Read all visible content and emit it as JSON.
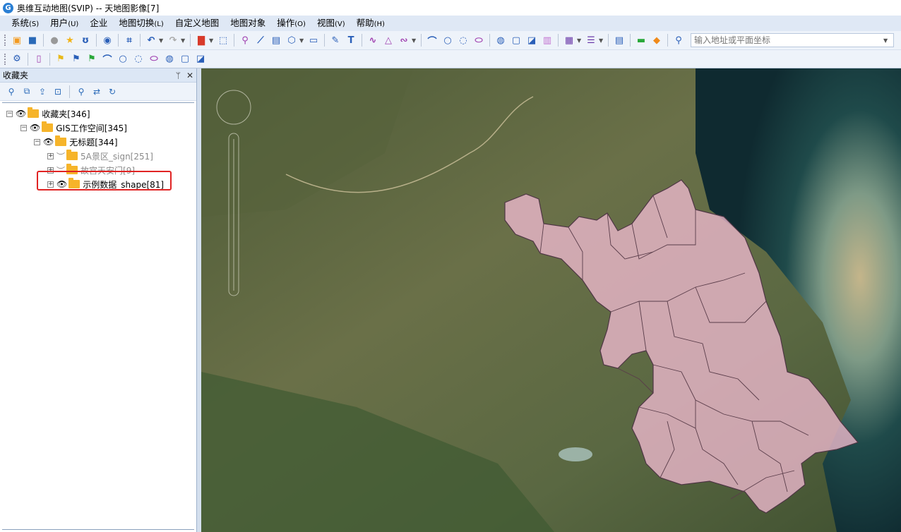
{
  "window": {
    "title": "奥维互动地图(SVIP) -- 天地图影像[7]",
    "icon": "app-logo-icon"
  },
  "menu": [
    {
      "label": "系统",
      "key": "(S)"
    },
    {
      "label": "用户",
      "key": "(U)"
    },
    {
      "label": "企业",
      "key": ""
    },
    {
      "label": "地图切换",
      "key": "(L)"
    },
    {
      "label": "自定义地图",
      "key": ""
    },
    {
      "label": "地图对象",
      "key": ""
    },
    {
      "label": "操作",
      "key": "(O)"
    },
    {
      "label": "视图",
      "key": "(V)"
    },
    {
      "label": "帮助",
      "key": "(H)"
    }
  ],
  "search": {
    "placeholder": "输入地址或平面坐标"
  },
  "panel": {
    "title": "收藏夹",
    "pin_icon": "pin-icon",
    "close_icon": "close-icon"
  },
  "tree": {
    "root": "收藏夹[346]",
    "workspace": "GIS工作空间[345]",
    "untitled": "无标题[344]",
    "item1": "5A景区_sign[251]",
    "item2": "故宫天安门[9]",
    "item3": "示例数据_shape[81]"
  },
  "colors": {
    "highlight": "#e02424",
    "region_fill": "#e8b6c8",
    "region_stroke": "#5a3d4a",
    "folder": "#f6b42a"
  }
}
